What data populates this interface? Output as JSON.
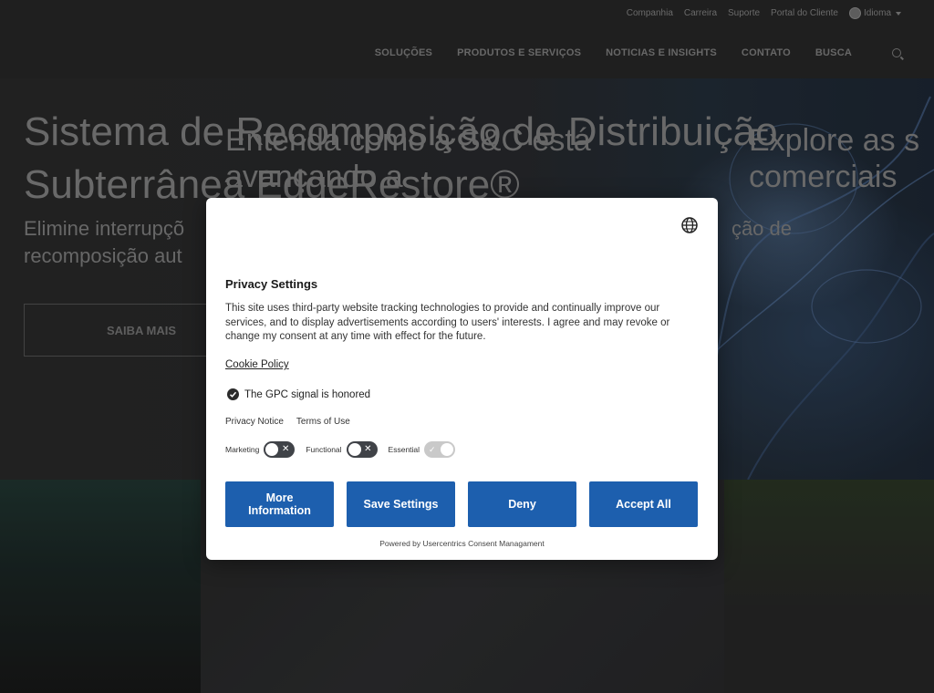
{
  "utility_nav": [
    "Companhia",
    "Carreira",
    "Suporte",
    "Portal do Cliente"
  ],
  "language_label": "Idioma",
  "main_nav": [
    "SOLUÇÕES",
    "PRODUTOS E SERVIÇOS",
    "NOTICIAS E INSIGHTS",
    "CONTATO",
    "BUSCA"
  ],
  "hero": {
    "title": "Sistema de Recomposição de Distribuição Subterrânea EdgeRestore®",
    "subtitle_left": "Elimine interrupçõ",
    "subtitle_right": "ção de",
    "subtitle_line2": "recomposição aut",
    "cta": "SAIBA MAIS"
  },
  "lower": {
    "mid_heading": "Entenda como a S&C está avançando a",
    "right_heading": "Explore as s comerciais"
  },
  "privacy": {
    "title": "Privacy Settings",
    "body": "This site uses third-party website tracking technologies to provide and continually improve our services, and to display advertisements according to users' interests. I agree and may revoke or change my consent at any time with effect for the future.",
    "cookie_policy": "Cookie Policy",
    "gpc_text": "The GPC signal is honored",
    "privacy_notice": "Privacy Notice",
    "terms_of_use": "Terms of Use",
    "toggles": {
      "marketing": "Marketing",
      "functional": "Functional",
      "essential": "Essential"
    },
    "buttons": {
      "more_info_line1": "More",
      "more_info_line2": "Information",
      "save": "Save Settings",
      "deny": "Deny",
      "accept": "Accept All"
    },
    "powered_by": "Powered by Usercentrics Consent Managament"
  },
  "colors": {
    "button_blue": "#1d5fae",
    "overlay_text": "#8d8d8d"
  }
}
